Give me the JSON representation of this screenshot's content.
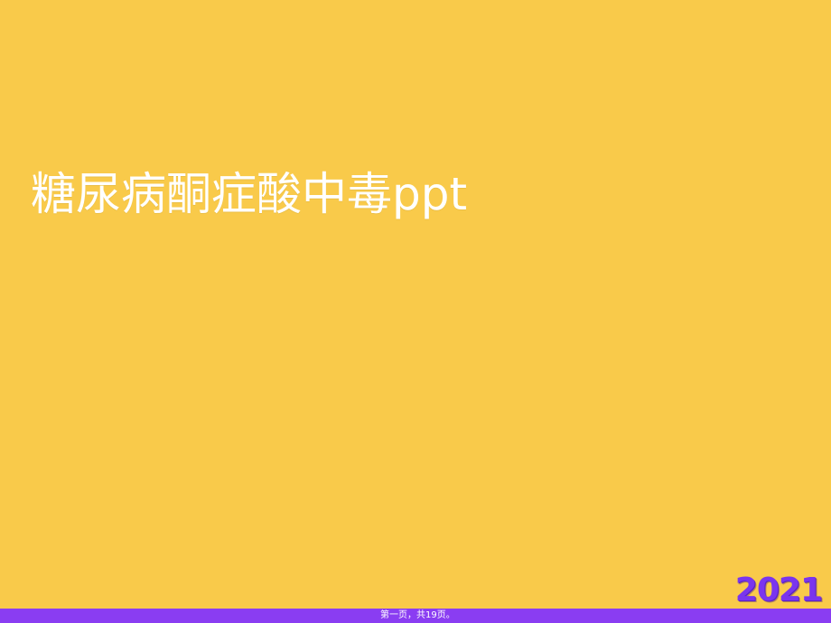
{
  "slide": {
    "title": "糖尿病酮症酸中毒ppt",
    "page_indicator": "第一页，共19页。",
    "year": "2021",
    "colors": {
      "background": "#F9CA4A",
      "bar": "#8A3DF2",
      "title_text": "#FFFFFF",
      "year_text": "#7A35EE"
    }
  }
}
